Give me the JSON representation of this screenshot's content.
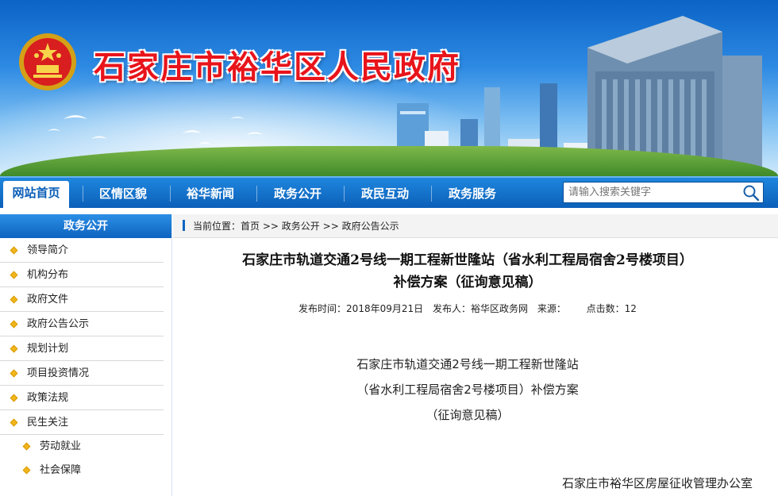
{
  "site": {
    "title": "石家庄市裕华区人民政府"
  },
  "nav": {
    "items": [
      {
        "label": "网站首页",
        "active": true
      },
      {
        "label": "区情区貌"
      },
      {
        "label": "裕华新闻"
      },
      {
        "label": "政务公开"
      },
      {
        "label": "政民互动"
      },
      {
        "label": "政务服务"
      }
    ],
    "search_placeholder": "请输入搜索关键字"
  },
  "sidebar": {
    "title": "政务公开",
    "items": [
      "领导简介",
      "机构分布",
      "政府文件",
      "政府公告公示",
      "规划计划",
      "项目投资情况",
      "政策法规",
      "民生关注"
    ],
    "sub_items": [
      "劳动就业",
      "社会保障"
    ]
  },
  "breadcrumb": {
    "prefix": "当前位置：",
    "items": [
      "首页",
      "政务公开",
      "政府公告公示"
    ],
    "separator": ">>"
  },
  "article": {
    "title_line1": "石家庄市轨道交通2号线一期工程新世隆站（省水利工程局宿舍2号楼项目）",
    "title_line2": "补偿方案（征询意见稿）",
    "publish_time_label": "发布时间：2018年09月21日",
    "publisher_label": "发布人：裕华区政务网",
    "source_label": "来源：",
    "clicks_label": "点击数：12",
    "body_line1": "石家庄市轨道交通2号线一期工程新世隆站",
    "body_line2": "（省水利工程局宿舍2号楼项目）补偿方案",
    "body_line3": "（征询意见稿）",
    "signature": "石家庄市裕华区房屋征收管理办公室"
  },
  "colors": {
    "nav_blue": "#0b5fb8",
    "title_red": "#e8141b",
    "bullet_gold": "#f2b61a"
  }
}
